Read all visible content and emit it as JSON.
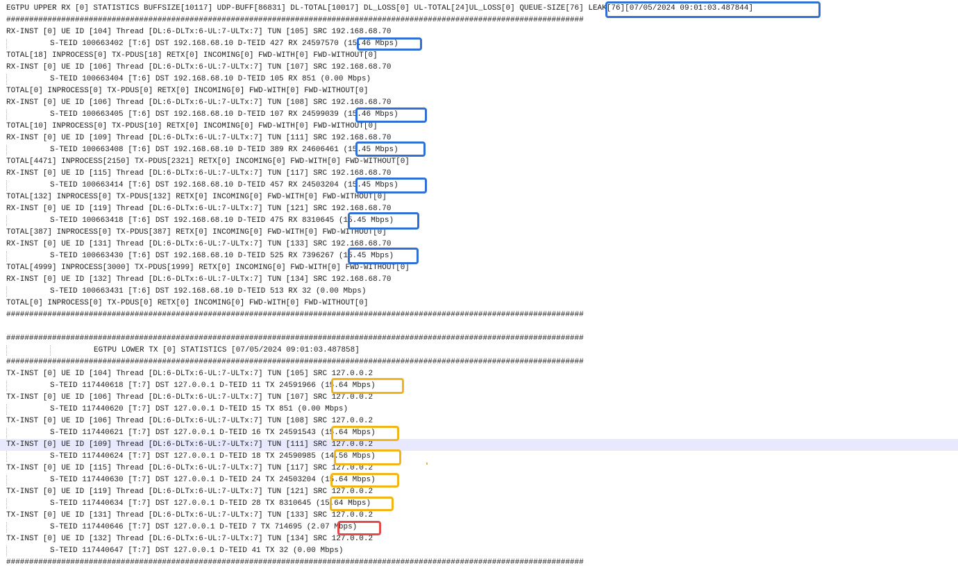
{
  "lines": [
    "EGTPU UPPER RX [0] STATISTICS BUFFSIZE[10117] UDP-BUFF[86831] DL-TOTAL[10017] DL_LOSS[0] UL-TOTAL[24]UL_LOSS[0] QUEUE-SIZE[76] LEAK[76][07/05/2024 09:01:03.487844]",
    "##############################################################################################################################",
    "RX-INST [0] UE ID [104] Thread [DL:6-DLTx:6-UL:7-ULTx:7] TUN [105] SRC 192.168.68.70",
    "S-TEID 100663402 [T:6] DST 192.168.68.10 D-TEID 427 RX 24597570 (15.46 Mbps)",
    "TOTAL[18] INPROCESS[0] TX-PDUS[18] RETX[0] INCOMING[0] FWD-WITH[0] FWD-WITHOUT[0]",
    "RX-INST [0] UE ID [106] Thread [DL:6-DLTx:6-UL:7-ULTx:7] TUN [107] SRC 192.168.68.70",
    "S-TEID 100663404 [T:6] DST 192.168.68.10 D-TEID 105 RX 851 (0.00 Mbps)",
    "TOTAL[0] INPROCESS[0] TX-PDUS[0] RETX[0] INCOMING[0] FWD-WITH[0] FWD-WITHOUT[0]",
    "RX-INST [0] UE ID [106] Thread [DL:6-DLTx:6-UL:7-ULTx:7] TUN [108] SRC 192.168.68.70",
    "S-TEID 100663405 [T:6] DST 192.168.68.10 D-TEID 107 RX 24599039 (15.46 Mbps)",
    "TOTAL[10] INPROCESS[0] TX-PDUS[10] RETX[0] INCOMING[0] FWD-WITH[0] FWD-WITHOUT[0]",
    "RX-INST [0] UE ID [109] Thread [DL:6-DLTx:6-UL:7-ULTx:7] TUN [111] SRC 192.168.68.70",
    "S-TEID 100663408 [T:6] DST 192.168.68.10 D-TEID 389 RX 24606461 (15.45 Mbps)",
    "TOTAL[4471] INPROCESS[2150] TX-PDUS[2321] RETX[0] INCOMING[0] FWD-WITH[0] FWD-WITHOUT[0]",
    "RX-INST [0] UE ID [115] Thread [DL:6-DLTx:6-UL:7-ULTx:7] TUN [117] SRC 192.168.68.70",
    "S-TEID 100663414 [T:6] DST 192.168.68.10 D-TEID 457 RX 24503204 (15.45 Mbps)",
    "TOTAL[132] INPROCESS[0] TX-PDUS[132] RETX[0] INCOMING[0] FWD-WITH[0] FWD-WITHOUT[0]",
    "RX-INST [0] UE ID [119] Thread [DL:6-DLTx:6-UL:7-ULTx:7] TUN [121] SRC 192.168.68.70",
    "S-TEID 100663418 [T:6] DST 192.168.68.10 D-TEID 475 RX 8310645 (15.45 Mbps)",
    "TOTAL[387] INPROCESS[0] TX-PDUS[387] RETX[0] INCOMING[0] FWD-WITH[0] FWD-WITHOUT[0]",
    "RX-INST [0] UE ID [131] Thread [DL:6-DLTx:6-UL:7-ULTx:7] TUN [133] SRC 192.168.68.70",
    "S-TEID 100663430 [T:6] DST 192.168.68.10 D-TEID 525 RX 7396267 (15.45 Mbps)",
    "TOTAL[4999] INPROCESS[3000] TX-PDUS[1999] RETX[0] INCOMING[0] FWD-WITH[0] FWD-WITHOUT[0]",
    "RX-INST [0] UE ID [132] Thread [DL:6-DLTx:6-UL:7-ULTx:7] TUN [134] SRC 192.168.68.70",
    "S-TEID 100663431 [T:6] DST 192.168.68.10 D-TEID 513 RX 32 (0.00 Mbps)",
    "TOTAL[0] INPROCESS[0] TX-PDUS[0] RETX[0] INCOMING[0] FWD-WITH[0] FWD-WITHOUT[0]",
    "##############################################################################################################################",
    "",
    "##############################################################################################################################",
    "EGTPU LOWER TX [0] STATISTICS [07/05/2024 09:01:03.487858]",
    "##############################################################################################################################",
    "TX-INST [0] UE ID [104] Thread [DL:6-DLTx:6-UL:7-ULTx:7] TUN [105] SRC 127.0.0.2",
    "S-TEID 117440618 [T:7] DST 127.0.0.1 D-TEID 11 TX 24591966 (15.64 Mbps)",
    "TX-INST [0] UE ID [106] Thread [DL:6-DLTx:6-UL:7-ULTx:7] TUN [107] SRC 127.0.0.2",
    "S-TEID 117440620 [T:7] DST 127.0.0.1 D-TEID 15 TX 851 (0.00 Mbps)",
    "TX-INST [0] UE ID [106] Thread [DL:6-DLTx:6-UL:7-ULTx:7] TUN [108] SRC 127.0.0.2",
    "S-TEID 117440621 [T:7] DST 127.0.0.1 D-TEID 16 TX 24591543 (15.64 Mbps)",
    "TX-INST [0] UE ID [109] Thread [DL:6-DLTx:6-UL:7-ULTx:7] TUN [111] SRC 127.0.0.2",
    "S-TEID 117440624 [T:7] DST 127.0.0.1 D-TEID 18 TX 24590985 (14.56 Mbps)",
    "TX-INST [0] UE ID [115] Thread [DL:6-DLTx:6-UL:7-ULTx:7] TUN [117] SRC 127.0.0.2",
    "S-TEID 117440630 [T:7] DST 127.0.0.1 D-TEID 24 TX 24503204 (15.64 Mbps)",
    "TX-INST [0] UE ID [119] Thread [DL:6-DLTx:6-UL:7-ULTx:7] TUN [121] SRC 127.0.0.2",
    "S-TEID 117440634 [T:7] DST 127.0.0.1 D-TEID 28 TX 8310645 (15.64 Mbps)",
    "TX-INST [0] UE ID [131] Thread [DL:6-DLTx:6-UL:7-ULTx:7] TUN [133] SRC 127.0.0.2",
    "S-TEID 117440646 [T:7] DST 127.0.0.1 D-TEID 7 TX 714695 (2.07 Mbps)",
    "TX-INST [0] UE ID [132] Thread [DL:6-DLTx:6-UL:7-ULTx:7] TUN [134] SRC 127.0.0.2",
    "S-TEID 117440647 [T:7] DST 127.0.0.1 D-TEID 41 TX 32 (0.00 Mbps)",
    "##############################################################################################################################"
  ],
  "highlight_colors": {
    "blue": "#2f6fd6",
    "yellow": "#f2b417",
    "red": "#e24b4b",
    "current_line": "#e8e8ff"
  }
}
